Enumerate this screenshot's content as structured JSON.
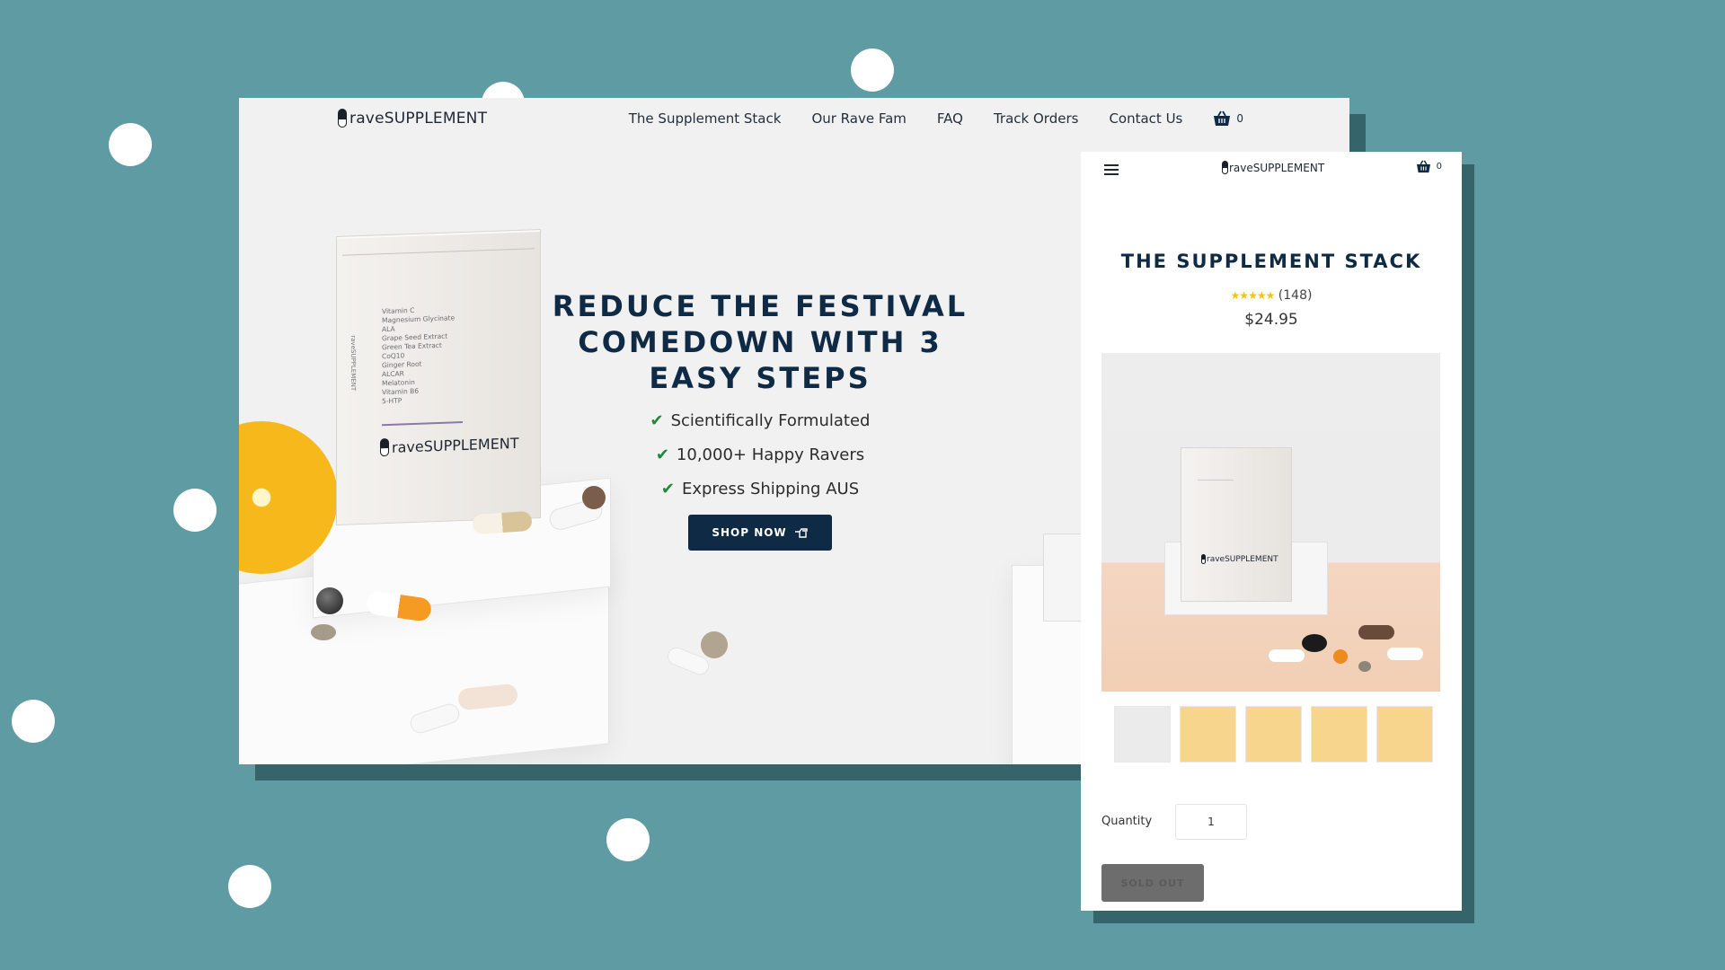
{
  "brand": {
    "logo_text": "raveSUPPLEMENT"
  },
  "desktop": {
    "nav": [
      "The Supplement Stack",
      "Our Rave Fam",
      "FAQ",
      "Track Orders",
      "Contact Us"
    ],
    "cart_count": "0",
    "hero": {
      "title": "REDUCE THE FESTIVAL COMEDOWN WITH 3 EASY STEPS",
      "features": [
        "Scientifically Formulated",
        "10,000+ Happy Ravers",
        "Express Shipping AUS"
      ],
      "cta_label": "SHOP NOW"
    },
    "box_ingredients": [
      "Vitamin C",
      "Magnesium Glycinate",
      "ALA",
      "Grape Seed Extract",
      "Green Tea Extract",
      "CoQ10",
      "Ginger Root",
      "ALCAR",
      "Melatonin",
      "Vitamin B6",
      "5-HTP"
    ]
  },
  "mobile": {
    "cart_count": "0",
    "product_title": "THE SUPPLEMENT STACK",
    "rating_stars": "★★★★★",
    "rating_count": "(148)",
    "price": "$24.95",
    "thumbnail_count": 5,
    "quantity_label": "Quantity",
    "quantity_value": "1",
    "sold_out_label": "SOLD OUT"
  },
  "colors": {
    "background": "#5e9ba3",
    "navy": "#0e2a44",
    "check_green": "#1e8a35",
    "star_yellow": "#f2c318",
    "thumb_yellow": "#f8d58c"
  },
  "icons": [
    "cart-icon",
    "check-icon",
    "hand-pointer-icon",
    "hamburger-icon",
    "pill-logo-icon"
  ]
}
